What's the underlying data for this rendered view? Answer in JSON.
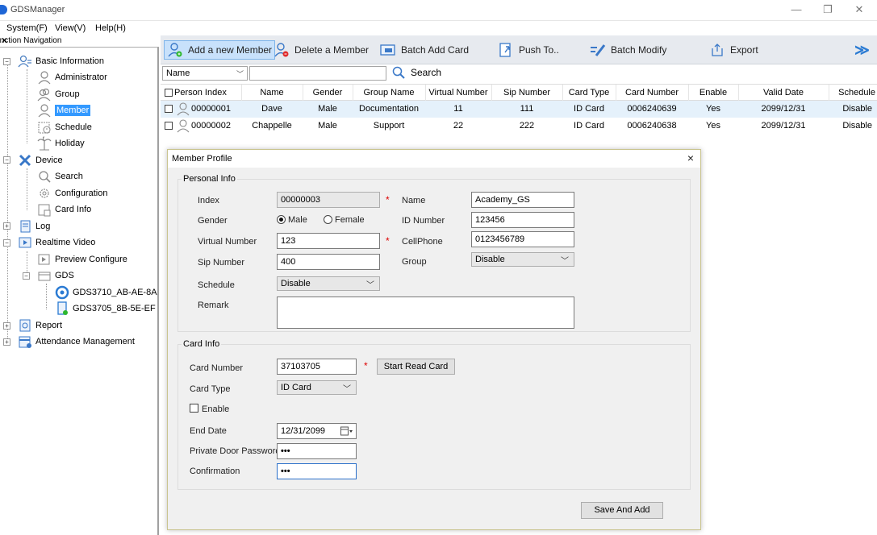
{
  "app": {
    "title": "GDSManager",
    "window_controls": {
      "minimize": "—",
      "maximize": "❐",
      "close": "✕"
    }
  },
  "menu": [
    "System(F)",
    "View(V)",
    "Help(H)"
  ],
  "nav": {
    "header": "Function Navigation",
    "close": "×",
    "items": [
      {
        "label": "Basic Information",
        "icon": "users-icon"
      },
      {
        "label": "Administrator",
        "icon": "admin-icon"
      },
      {
        "label": "Group",
        "icon": "group-icon"
      },
      {
        "label": "Member",
        "icon": "member-icon"
      },
      {
        "label": "Schedule",
        "icon": "schedule-icon"
      },
      {
        "label": "Holiday",
        "icon": "holiday-icon"
      },
      {
        "label": "Device",
        "icon": "tools-icon"
      },
      {
        "label": "Search",
        "icon": "search-icon"
      },
      {
        "label": "Configuration",
        "icon": "gear-icon"
      },
      {
        "label": "Card Info",
        "icon": "card-icon"
      },
      {
        "label": "Log",
        "icon": "log-icon"
      },
      {
        "label": "Realtime Video",
        "icon": "video-icon"
      },
      {
        "label": "Preview Configure",
        "icon": "preview-icon"
      },
      {
        "label": "GDS",
        "icon": "folder-icon"
      },
      {
        "label": "GDS3710_AB-AE-8A",
        "icon": "camera-icon"
      },
      {
        "label": "GDS3705_8B-5E-EF",
        "icon": "device-icon"
      },
      {
        "label": "Report",
        "icon": "report-icon"
      },
      {
        "label": "Attendance Management",
        "icon": "attendance-icon"
      }
    ]
  },
  "toolbar": {
    "add_member": "Add a new Member",
    "delete_member": "Delete a Member",
    "batch_add_card": "Batch Add Card",
    "push_to": "Push To..",
    "batch_modify": "Batch Modify",
    "export": "Export",
    "more": "≫"
  },
  "search": {
    "field": "Name",
    "value": "",
    "button": "Search"
  },
  "table": {
    "columns": [
      "Person Index",
      "Name",
      "Gender",
      "Group Name",
      "Virtual Number",
      "Sip Number",
      "Card Type",
      "Card Number",
      "Enable",
      "Valid Date",
      "Schedule"
    ],
    "rows": [
      [
        "00000001",
        "Dave",
        "Male",
        "Documentation",
        "11",
        "111",
        "ID Card",
        "0006240639",
        "Yes",
        "2099/12/31",
        "Disable"
      ],
      [
        "00000002",
        "Chappelle",
        "Male",
        "Support",
        "22",
        "222",
        "ID Card",
        "0006240638",
        "Yes",
        "2099/12/31",
        "Disable"
      ]
    ]
  },
  "dialog": {
    "title": "Member Profile",
    "close": "×",
    "personal_info": {
      "legend": "Personal Info",
      "index_label": "Index",
      "index_value": "00000003",
      "name_label": "Name",
      "name_value": "Academy_GS",
      "gender_label": "Gender",
      "gender_male": "Male",
      "gender_female": "Female",
      "id_number_label": "ID Number",
      "id_number_value": "123456",
      "virtual_number_label": "Virtual Number",
      "virtual_number_value": "123",
      "cellphone_label": "CellPhone",
      "cellphone_value": "0123456789",
      "sip_number_label": "Sip Number",
      "sip_number_value": "400",
      "group_label": "Group",
      "group_value": "Disable",
      "schedule_label": "Schedule",
      "schedule_value": "Disable",
      "remark_label": "Remark",
      "remark_value": ""
    },
    "card_info": {
      "legend": "Card Info",
      "card_number_label": "Card Number",
      "card_number_value": "37103705",
      "start_read_card": "Start Read Card",
      "card_type_label": "Card Type",
      "card_type_value": "ID Card",
      "enable_label": "Enable",
      "end_date_label": "End Date",
      "end_date_value": "12/31/2099",
      "door_password_label": "Private Door Password",
      "door_password_value": "•••",
      "confirmation_label": "Confirmation",
      "confirmation_value": "•••"
    },
    "save_and_add": "Save And Add",
    "required_mark": "*"
  }
}
